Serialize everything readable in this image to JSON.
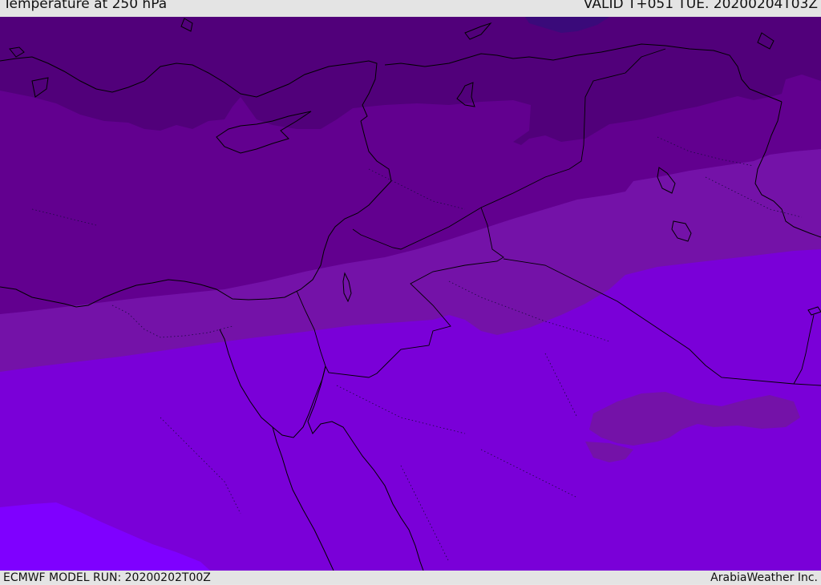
{
  "header": {
    "title": "Temperature at 250 hPa",
    "valid_time": "VALID T+051 TUE. 20200204T03Z"
  },
  "footer": {
    "model_run": "ECMWF MODEL RUN: 20200202T00Z",
    "credit": "ArabiaWeather Inc."
  },
  "colors": {
    "band_darkest": "#3a0a7a",
    "band_1": "#51007a",
    "band_2": "#62008f",
    "band_3": "#7412a8",
    "band_4": "#7a00d8",
    "band_5": "#7f00ff",
    "coastline": "#000000",
    "frame": "#e4e4e4"
  }
}
